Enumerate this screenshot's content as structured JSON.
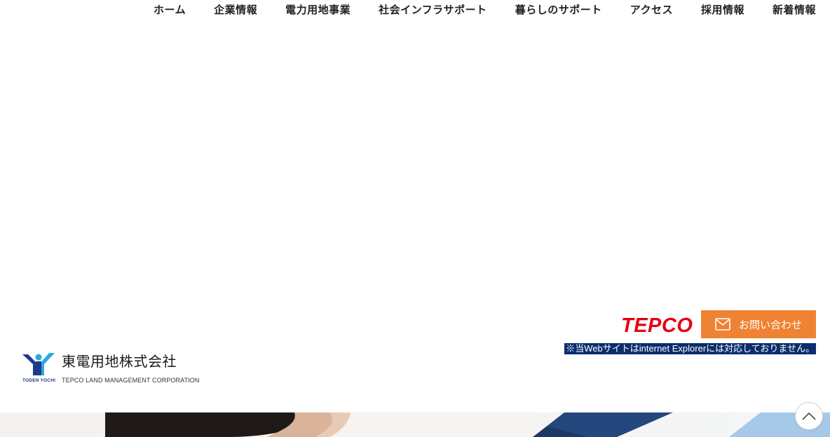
{
  "nav": {
    "items": [
      {
        "label": "ホーム"
      },
      {
        "label": "企業情報"
      },
      {
        "label": "電力用地事業"
      },
      {
        "label": "社会インフラサポート"
      },
      {
        "label": "暮らしのサポート"
      },
      {
        "label": "アクセス"
      },
      {
        "label": "採用情報"
      },
      {
        "label": "新着情報"
      }
    ]
  },
  "brand": {
    "mark_caption": "TODEN YOCHI",
    "name": "東電用地株式会社",
    "sub": "TEPCO LAND MANAGEMENT CORPORATION",
    "mark_icon": "toden-yochi-logo-icon",
    "colors": {
      "dark_blue": "#1f3a8a",
      "light_blue": "#27a9e1"
    }
  },
  "partner": {
    "logo_text": "TEPCO",
    "logo_color": "#e60012"
  },
  "contact": {
    "label": "お問い合わせ",
    "icon": "mail-icon",
    "color": "#f08233"
  },
  "notice": {
    "text": "※当Webサイトはinternet Explorerには対応しておりません。",
    "background": "#0a2d6e"
  },
  "back_to_top": {
    "icon": "chevron-up-icon"
  }
}
